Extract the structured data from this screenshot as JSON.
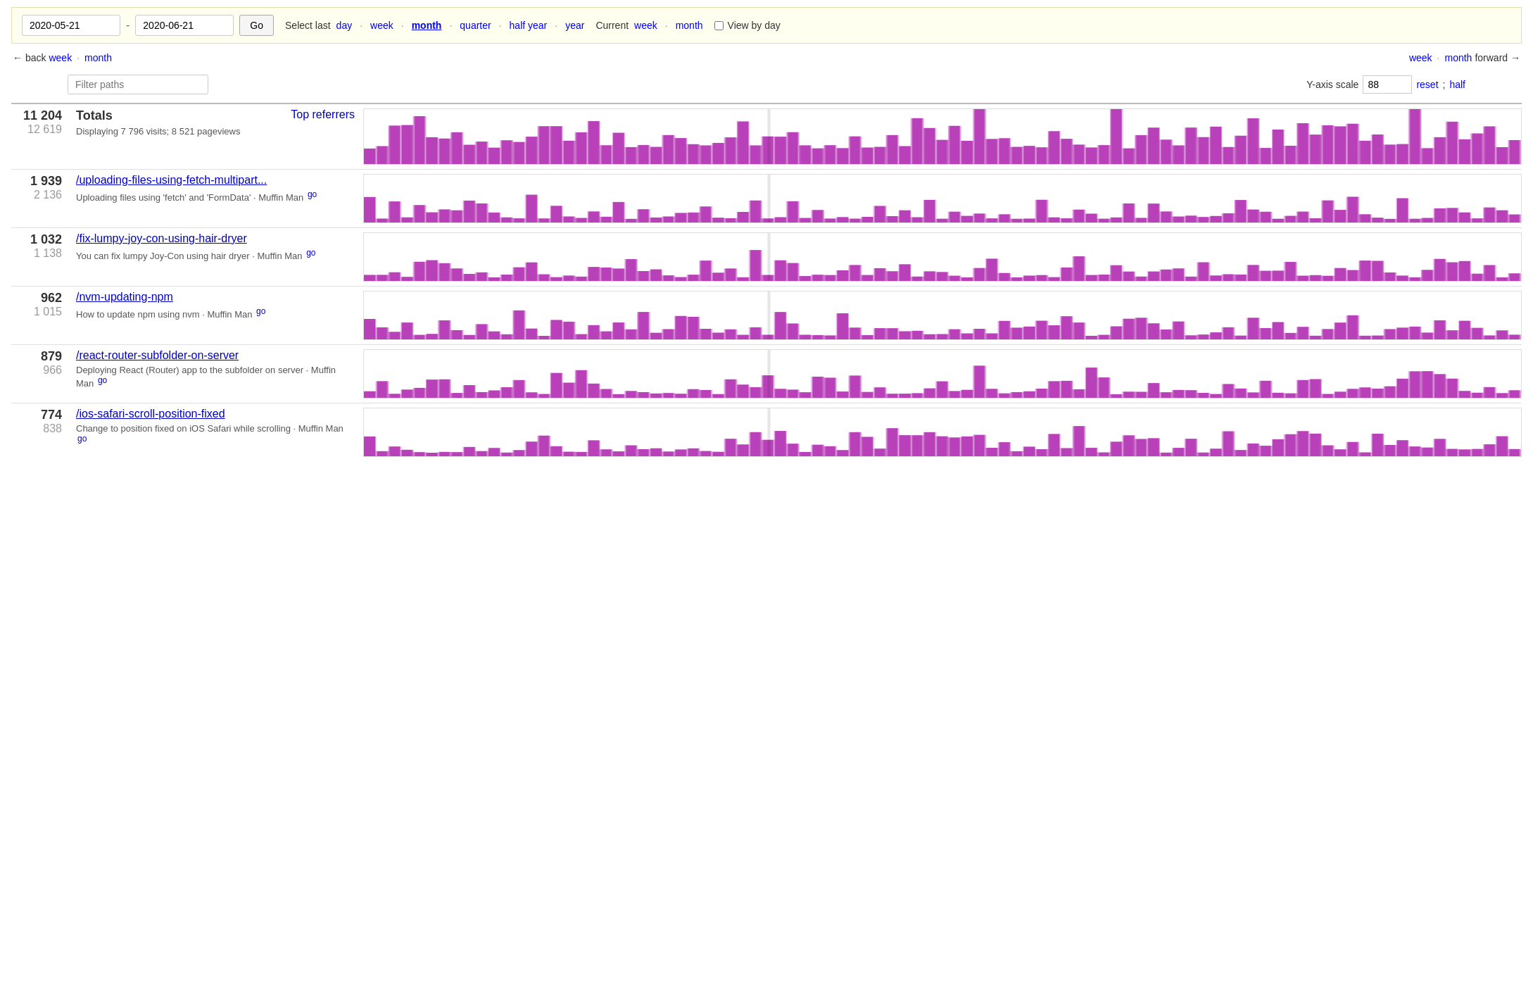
{
  "topbar": {
    "date_from": "2020-05-21",
    "date_to": "2020-06-21",
    "go_label": "Go",
    "select_text": "Select last",
    "links": [
      "day",
      "week",
      "month",
      "quarter",
      "half year",
      "year"
    ],
    "active_link": "month",
    "current_text": "Current",
    "current_links": [
      "week",
      "month"
    ],
    "view_by_day_label": "View by day"
  },
  "nav": {
    "back_label": "← back",
    "forward_label": "forward →",
    "nav_links": [
      "week",
      "month"
    ]
  },
  "controls": {
    "filter_placeholder": "Filter paths",
    "y_axis_label": "Y-axis scale",
    "y_axis_value": "88",
    "reset_label": "reset",
    "half_label": "half"
  },
  "rows": [
    {
      "primary": "11 204",
      "secondary": "12 619",
      "title": "Totals",
      "top_ref_label": "Top referrers",
      "desc": "Displaying  7 796 visits;  8 521 pageviews",
      "is_totals": true
    },
    {
      "primary": "1 939",
      "secondary": "2 136",
      "link_text": "/uploading-files-using-fetch-multipart...",
      "desc": "Uploading files using 'fetch' and 'FormData' · Muffin Man",
      "go_label": "go"
    },
    {
      "primary": "1 032",
      "secondary": "1 138",
      "link_text": "/fix-lumpy-joy-con-using-hair-dryer",
      "desc": "You can fix lumpy Joy-Con using hair dryer · Muffin Man",
      "go_label": "go"
    },
    {
      "primary": "962",
      "secondary": "1 015",
      "link_text": "/nvm-updating-npm",
      "desc": "How to update npm using nvm · Muffin Man",
      "go_label": "go"
    },
    {
      "primary": "879",
      "secondary": "966",
      "link_text": "/react-router-subfolder-on-server",
      "desc": "Deploying React (Router) app to the subfolder on server · Muffin Man",
      "go_label": "go"
    },
    {
      "primary": "774",
      "secondary": "838",
      "link_text": "/ios-safari-scroll-position-fixed",
      "desc": "Change to position fixed on iOS Safari while scrolling · Muffin Man",
      "go_label": "go"
    }
  ]
}
